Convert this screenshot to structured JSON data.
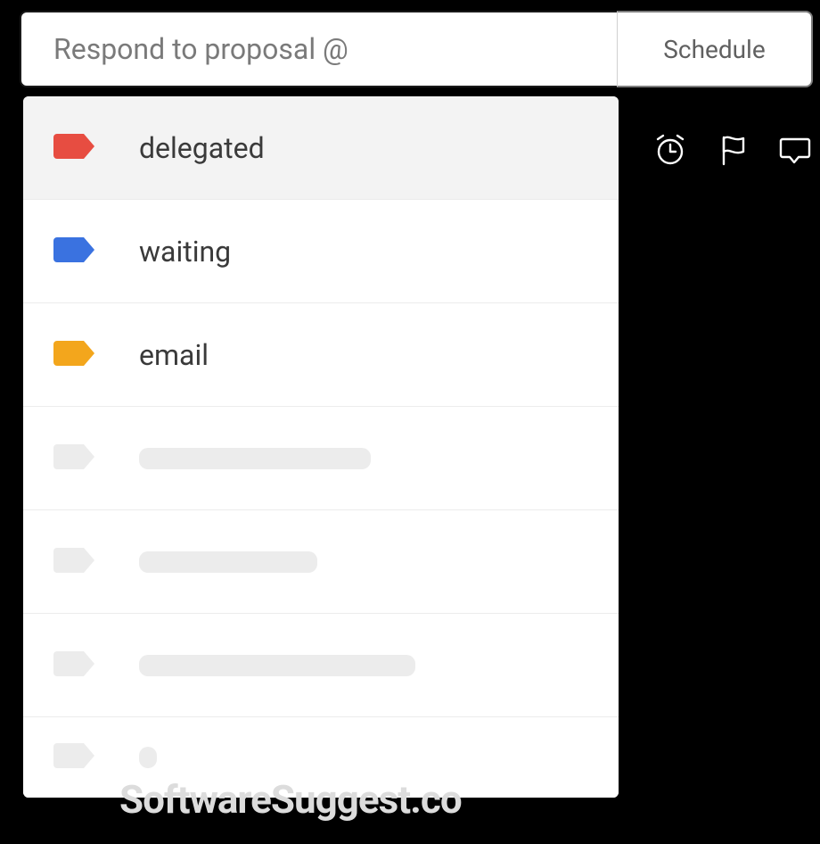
{
  "input": {
    "value": "Respond to proposal @"
  },
  "schedule": {
    "label": "Schedule"
  },
  "tags": [
    {
      "label": "delegated",
      "color": "#e74d41",
      "placeholder": false,
      "highlight": true,
      "skelWidth": 0
    },
    {
      "label": "waiting",
      "color": "#3a72e0",
      "placeholder": false,
      "highlight": false,
      "skelWidth": 0
    },
    {
      "label": "email",
      "color": "#f3a61c",
      "placeholder": false,
      "highlight": false,
      "skelWidth": 0
    },
    {
      "label": "",
      "color": "#ececec",
      "placeholder": true,
      "highlight": false,
      "skelWidth": 260
    },
    {
      "label": "",
      "color": "#ececec",
      "placeholder": true,
      "highlight": false,
      "skelWidth": 200
    },
    {
      "label": "",
      "color": "#ececec",
      "placeholder": true,
      "highlight": false,
      "skelWidth": 310
    },
    {
      "label": "",
      "color": "#ececec",
      "placeholder": true,
      "highlight": false,
      "skelWidth": 20
    }
  ],
  "watermark": "SoftwareSuggest.co"
}
